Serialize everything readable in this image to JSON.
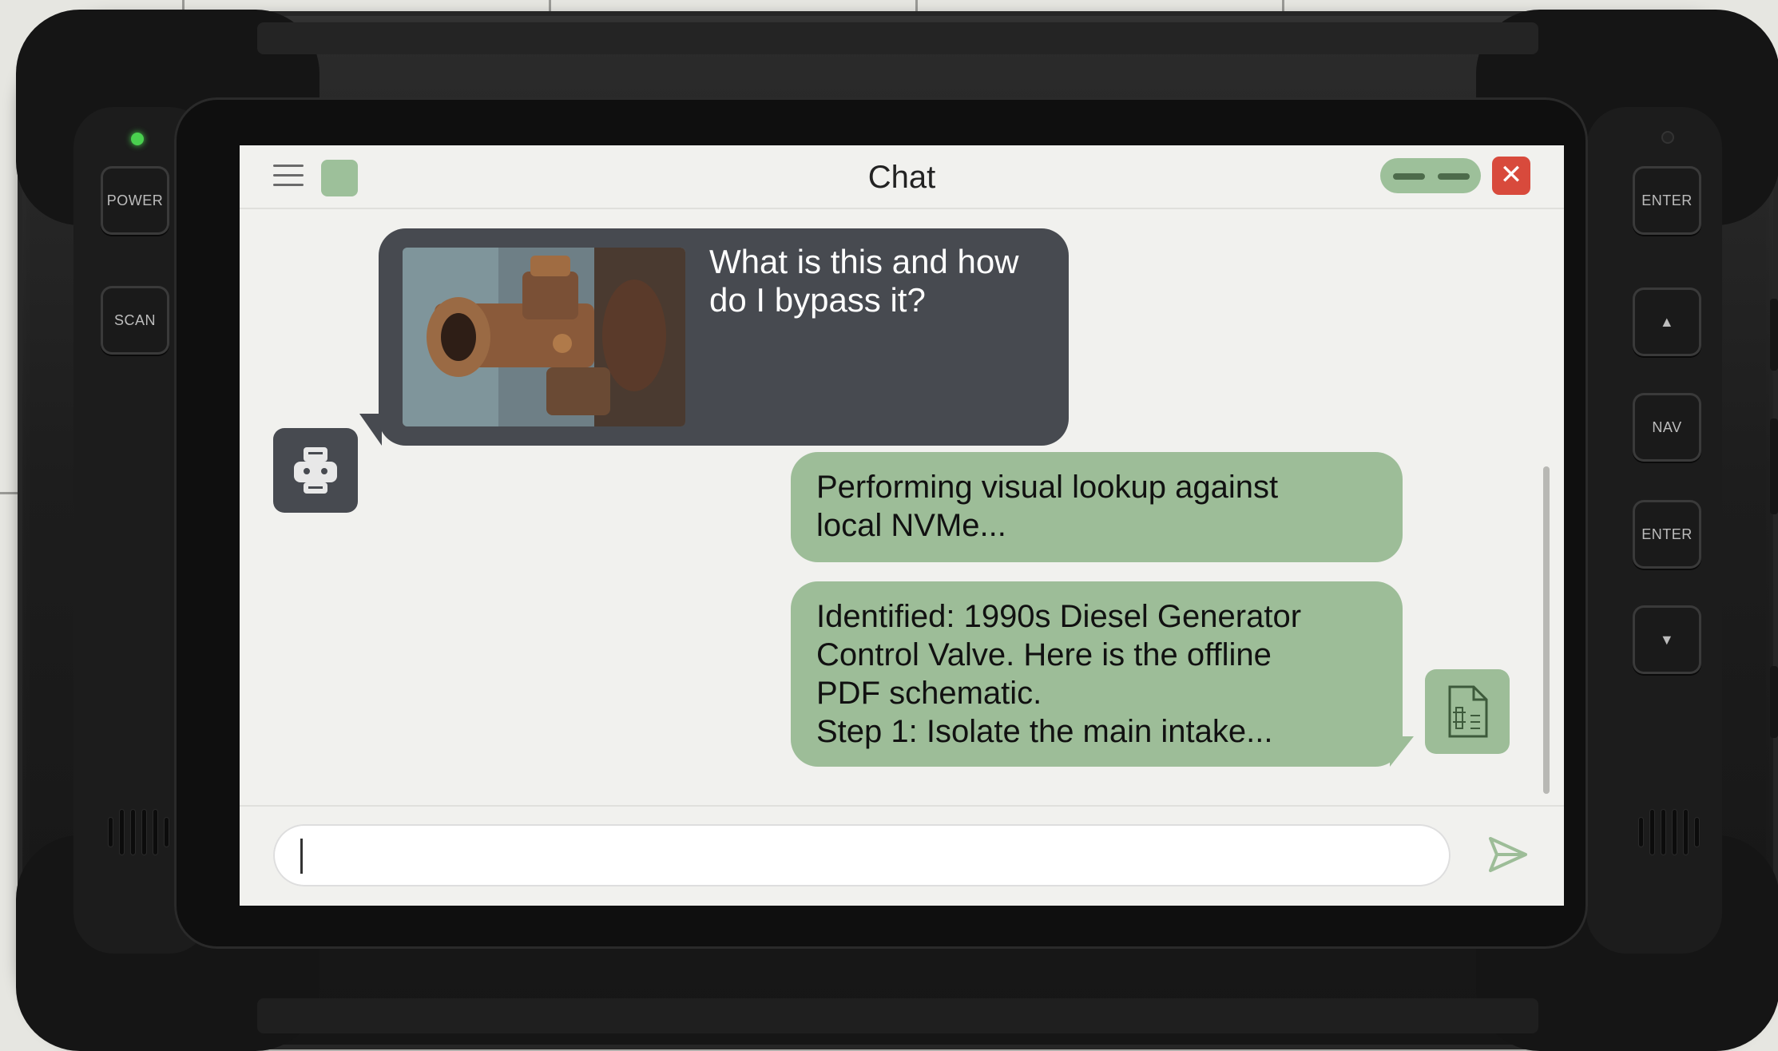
{
  "window": {
    "title": "Chat"
  },
  "hardware": {
    "left_buttons": [
      "POWER",
      "SCAN"
    ],
    "right_buttons": [
      "ENTER",
      "▲",
      "NAV",
      "ENTER",
      "▼"
    ]
  },
  "messages": [
    {
      "sender": "user",
      "text_lines": [
        "What is this and how",
        "do I bypass it?"
      ],
      "attachment": "photo of rusty valve"
    },
    {
      "sender": "assistant",
      "text_lines": [
        "Performing visual lookup against",
        "local NVMe..."
      ]
    },
    {
      "sender": "assistant",
      "text_lines": [
        "Identified: 1990s Diesel Generator",
        "Control Valve. Here is the offline",
        "PDF schematic.",
        "Step 1: Isolate the main intake..."
      ],
      "attachment_icon": "pdf-file-icon"
    }
  ],
  "composer": {
    "value": "",
    "placeholder": ""
  },
  "icons": {
    "menu": "hamburger-menu-icon",
    "app": "app-icon",
    "minimize": "window-controls-icon",
    "close": "close-icon",
    "send": "send-icon",
    "avatar": "robot-avatar-icon"
  },
  "colors": {
    "accent_green": "#9dbd98",
    "dark_bubble": "#474a50",
    "close_red": "#d84a3c",
    "led_green": "#4ad04f"
  }
}
